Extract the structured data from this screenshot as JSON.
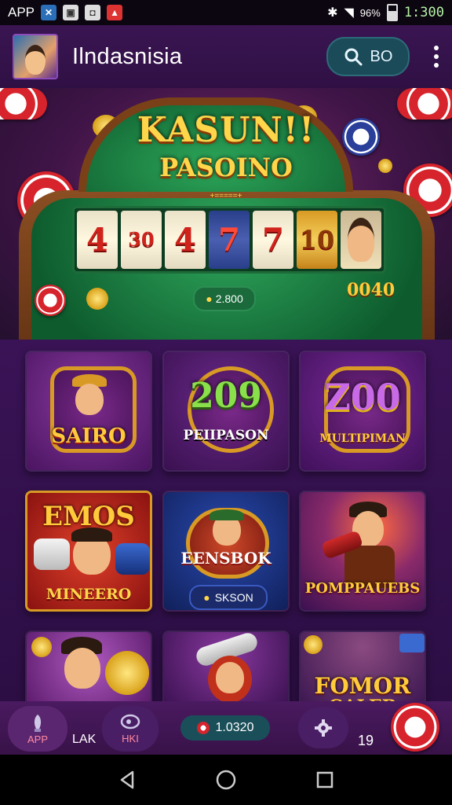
{
  "status_bar": {
    "app_label": "APP",
    "signal_text": "96%",
    "time": "1:300"
  },
  "app_bar": {
    "title": "Ilndasnisia",
    "search_label": "BO"
  },
  "hero": {
    "title_line1": "KASUN!!",
    "title_line2": "PASOINO",
    "subtitle": "+=====+",
    "reels": [
      "4",
      "30",
      "4",
      "7",
      "7",
      "10",
      ""
    ],
    "jackpot_pill": "2.800",
    "jackpot_label": "0040"
  },
  "games": [
    {
      "big": "",
      "label": "SAIRO"
    },
    {
      "big": "209",
      "label": "PEIIPASON"
    },
    {
      "big": "Z00",
      "label": "MULTIPIMAN"
    },
    {
      "big": "EMOS",
      "label": "MINEERO"
    },
    {
      "big": "",
      "label": "EENSBOK",
      "sub": "SKSON"
    },
    {
      "big": "",
      "label": "POMPPAUEBS"
    },
    {
      "big": "",
      "label": ""
    },
    {
      "big": "",
      "label": ""
    },
    {
      "big": "FOMOR",
      "label": "GALEB"
    }
  ],
  "bottom_nav": {
    "app_label": "APP",
    "lak_label": "LAK",
    "hki_label": "HKI",
    "balance": "1.0320",
    "count_label": "19"
  },
  "colors": {
    "background": "#2a0f3e",
    "accent_gold": "#ffd54a",
    "felt_green": "#1a7a40",
    "chip_red": "#d6232c"
  }
}
